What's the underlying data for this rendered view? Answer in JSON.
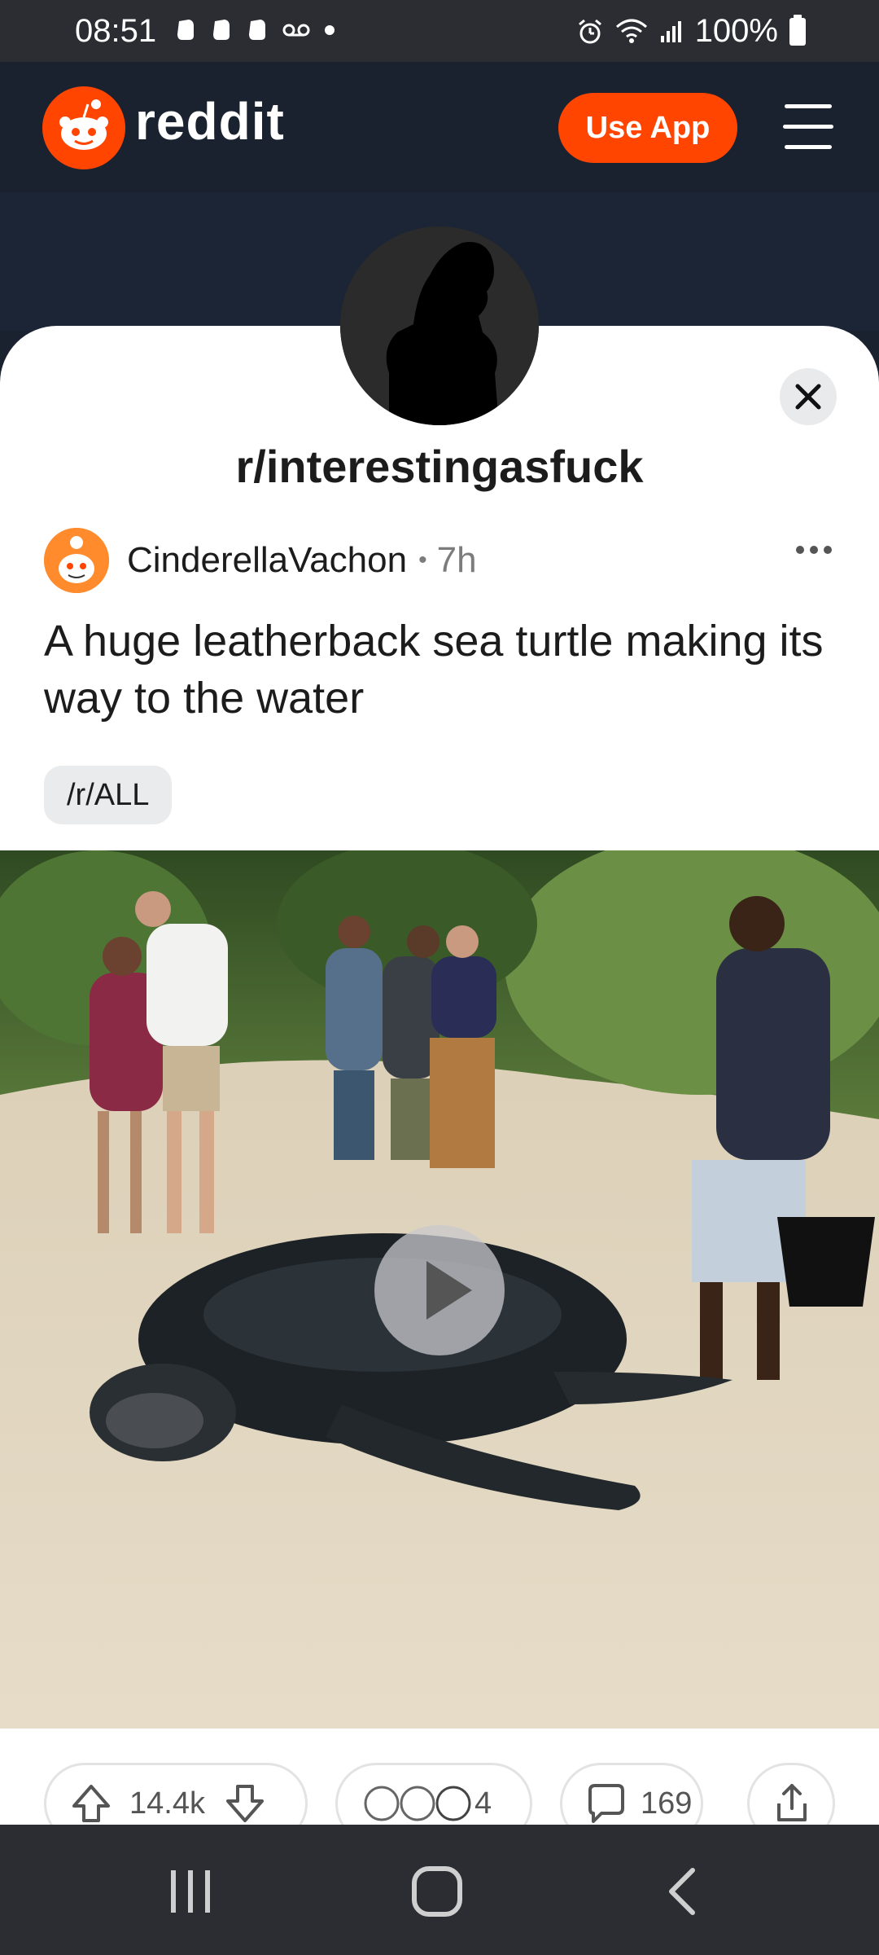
{
  "status_bar": {
    "time": "08:51",
    "battery": "100%"
  },
  "header": {
    "logo_text": "reddit",
    "use_app_label": "Use App",
    "brand_color": "#ff4500"
  },
  "post": {
    "subreddit": "r/interestingasfuck",
    "author": "CinderellaVachon",
    "separator": "•",
    "time_ago": "7h",
    "title": "A huge leatherback sea turtle making its way to the water",
    "flair": "/r/ALL"
  },
  "actions": {
    "upvotes": "14.4k",
    "awards_count": "4",
    "comments": "169"
  }
}
